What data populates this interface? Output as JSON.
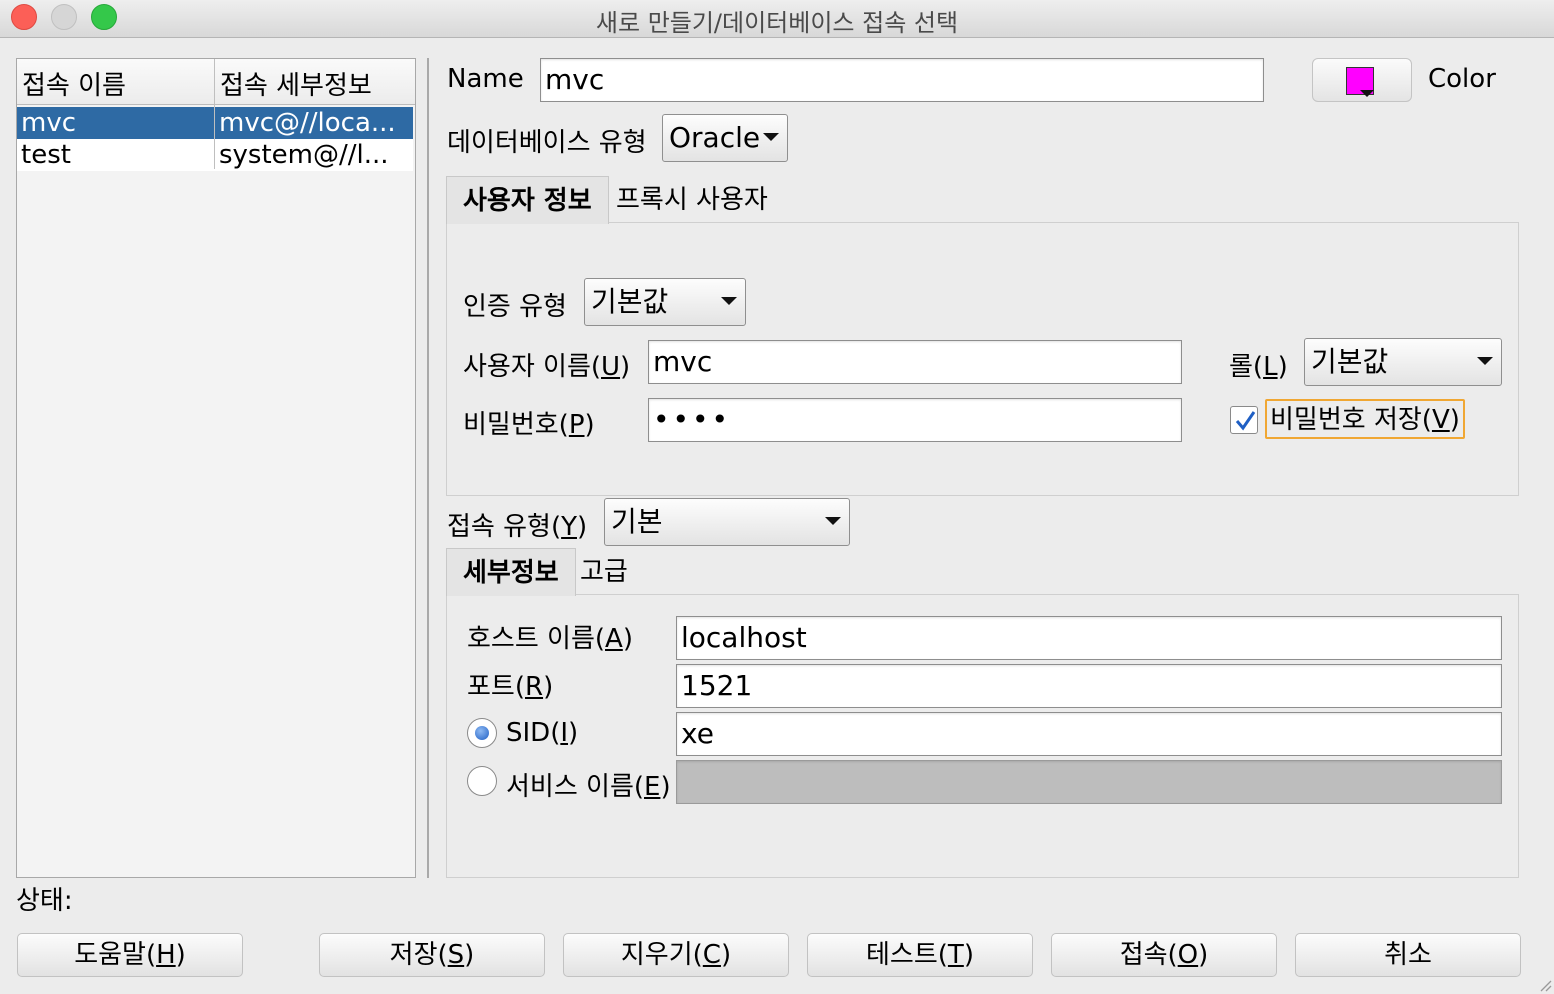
{
  "window": {
    "title": "새로 만들기/데이터베이스 접속 선택"
  },
  "connections": {
    "headers": {
      "name": "접속 이름",
      "details": "접속 세부정보"
    },
    "rows": [
      {
        "name": "mvc",
        "details": "mvc@//loca...",
        "selected": true
      },
      {
        "name": "test",
        "details": "system@//l...",
        "selected": false
      }
    ]
  },
  "form": {
    "name_label": "Name",
    "name_value": "mvc",
    "color_label": "Color",
    "color_swatch": "#ff00ff",
    "db_type_label": "데이터베이스 유형",
    "db_type_value": "Oracle",
    "user_tabs": {
      "user_info": "사용자 정보",
      "proxy_user": "프록시 사용자"
    },
    "auth_type_label": "인증 유형",
    "auth_type_value": "기본값",
    "username_label": "사용자 이름(",
    "username_mnemonic": "U",
    "username_value": "mvc",
    "role_label": "롤(",
    "role_mnemonic": "L",
    "role_value": "기본값",
    "password_label": "비밀번호(",
    "password_mnemonic": "P",
    "password_value": "••••",
    "save_password_label": "비밀번호 저장(",
    "save_password_mnemonic": "V",
    "save_password_checked": true,
    "conn_type_label": "접속 유형(",
    "conn_type_mnemonic": "Y",
    "conn_type_value": "기본",
    "detail_tabs": {
      "details": "세부정보",
      "advanced": "고급"
    },
    "host_label": "호스트 이름(",
    "host_mnemonic": "A",
    "host_value": "localhost",
    "port_label": "포트(",
    "port_mnemonic": "R",
    "port_value": "1521",
    "sid_label": "SID(",
    "sid_mnemonic": "I",
    "sid_value": "xe",
    "service_label": "서비스 이름(",
    "service_mnemonic": "E",
    "service_value": "",
    "selected_radio": "SID"
  },
  "status": {
    "label": "상태:"
  },
  "buttons": {
    "help": {
      "text": "도움말(",
      "mnemonic": "H"
    },
    "save": {
      "text": "저장(",
      "mnemonic": "S"
    },
    "clear": {
      "text": "지우기(",
      "mnemonic": "C"
    },
    "test": {
      "text": "테스트(",
      "mnemonic": "T"
    },
    "connect": {
      "text": "접속(",
      "mnemonic": "O"
    },
    "cancel": {
      "text": "취소"
    }
  },
  "colors": {
    "selection": "#2e6aa4",
    "focus_ring": "#f0a733",
    "accent": "#1f5fc4"
  }
}
